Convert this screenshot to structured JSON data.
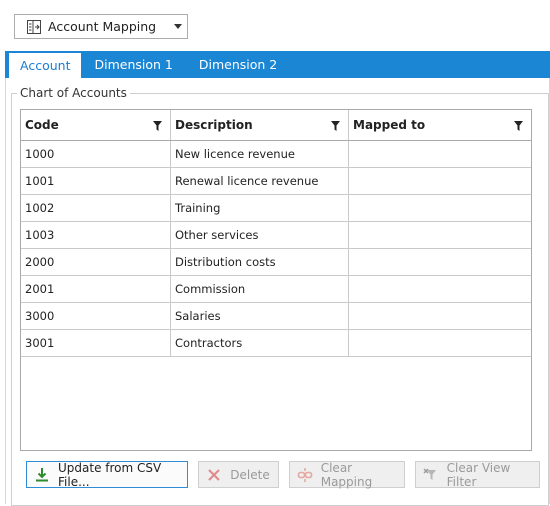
{
  "dropdown": {
    "label": "Account Mapping",
    "icon": "mapping-icon"
  },
  "tabs": [
    {
      "label": "Account",
      "active": true
    },
    {
      "label": "Dimension 1",
      "active": false
    },
    {
      "label": "Dimension 2",
      "active": false
    }
  ],
  "group": {
    "title": "Chart of Accounts"
  },
  "grid": {
    "columns": [
      "Code",
      "Description",
      "Mapped to"
    ],
    "rows": [
      {
        "code": "1000",
        "description": "New licence revenue",
        "mapped_to": ""
      },
      {
        "code": "1001",
        "description": "Renewal licence revenue",
        "mapped_to": ""
      },
      {
        "code": "1002",
        "description": "Training",
        "mapped_to": ""
      },
      {
        "code": "1003",
        "description": "Other services",
        "mapped_to": ""
      },
      {
        "code": "2000",
        "description": "Distribution costs",
        "mapped_to": ""
      },
      {
        "code": "2001",
        "description": "Commission",
        "mapped_to": ""
      },
      {
        "code": "3000",
        "description": "Salaries",
        "mapped_to": ""
      },
      {
        "code": "3001",
        "description": "Contractors",
        "mapped_to": ""
      }
    ]
  },
  "buttons": {
    "update_csv": "Update from CSV File...",
    "delete": "Delete",
    "clear_mapping": "Clear Mapping",
    "clear_view_filter": "Clear View Filter"
  },
  "colors": {
    "accent": "#1a86d4",
    "delete_icon": "#d9534f",
    "csv_icon": "#2e8b2e"
  }
}
